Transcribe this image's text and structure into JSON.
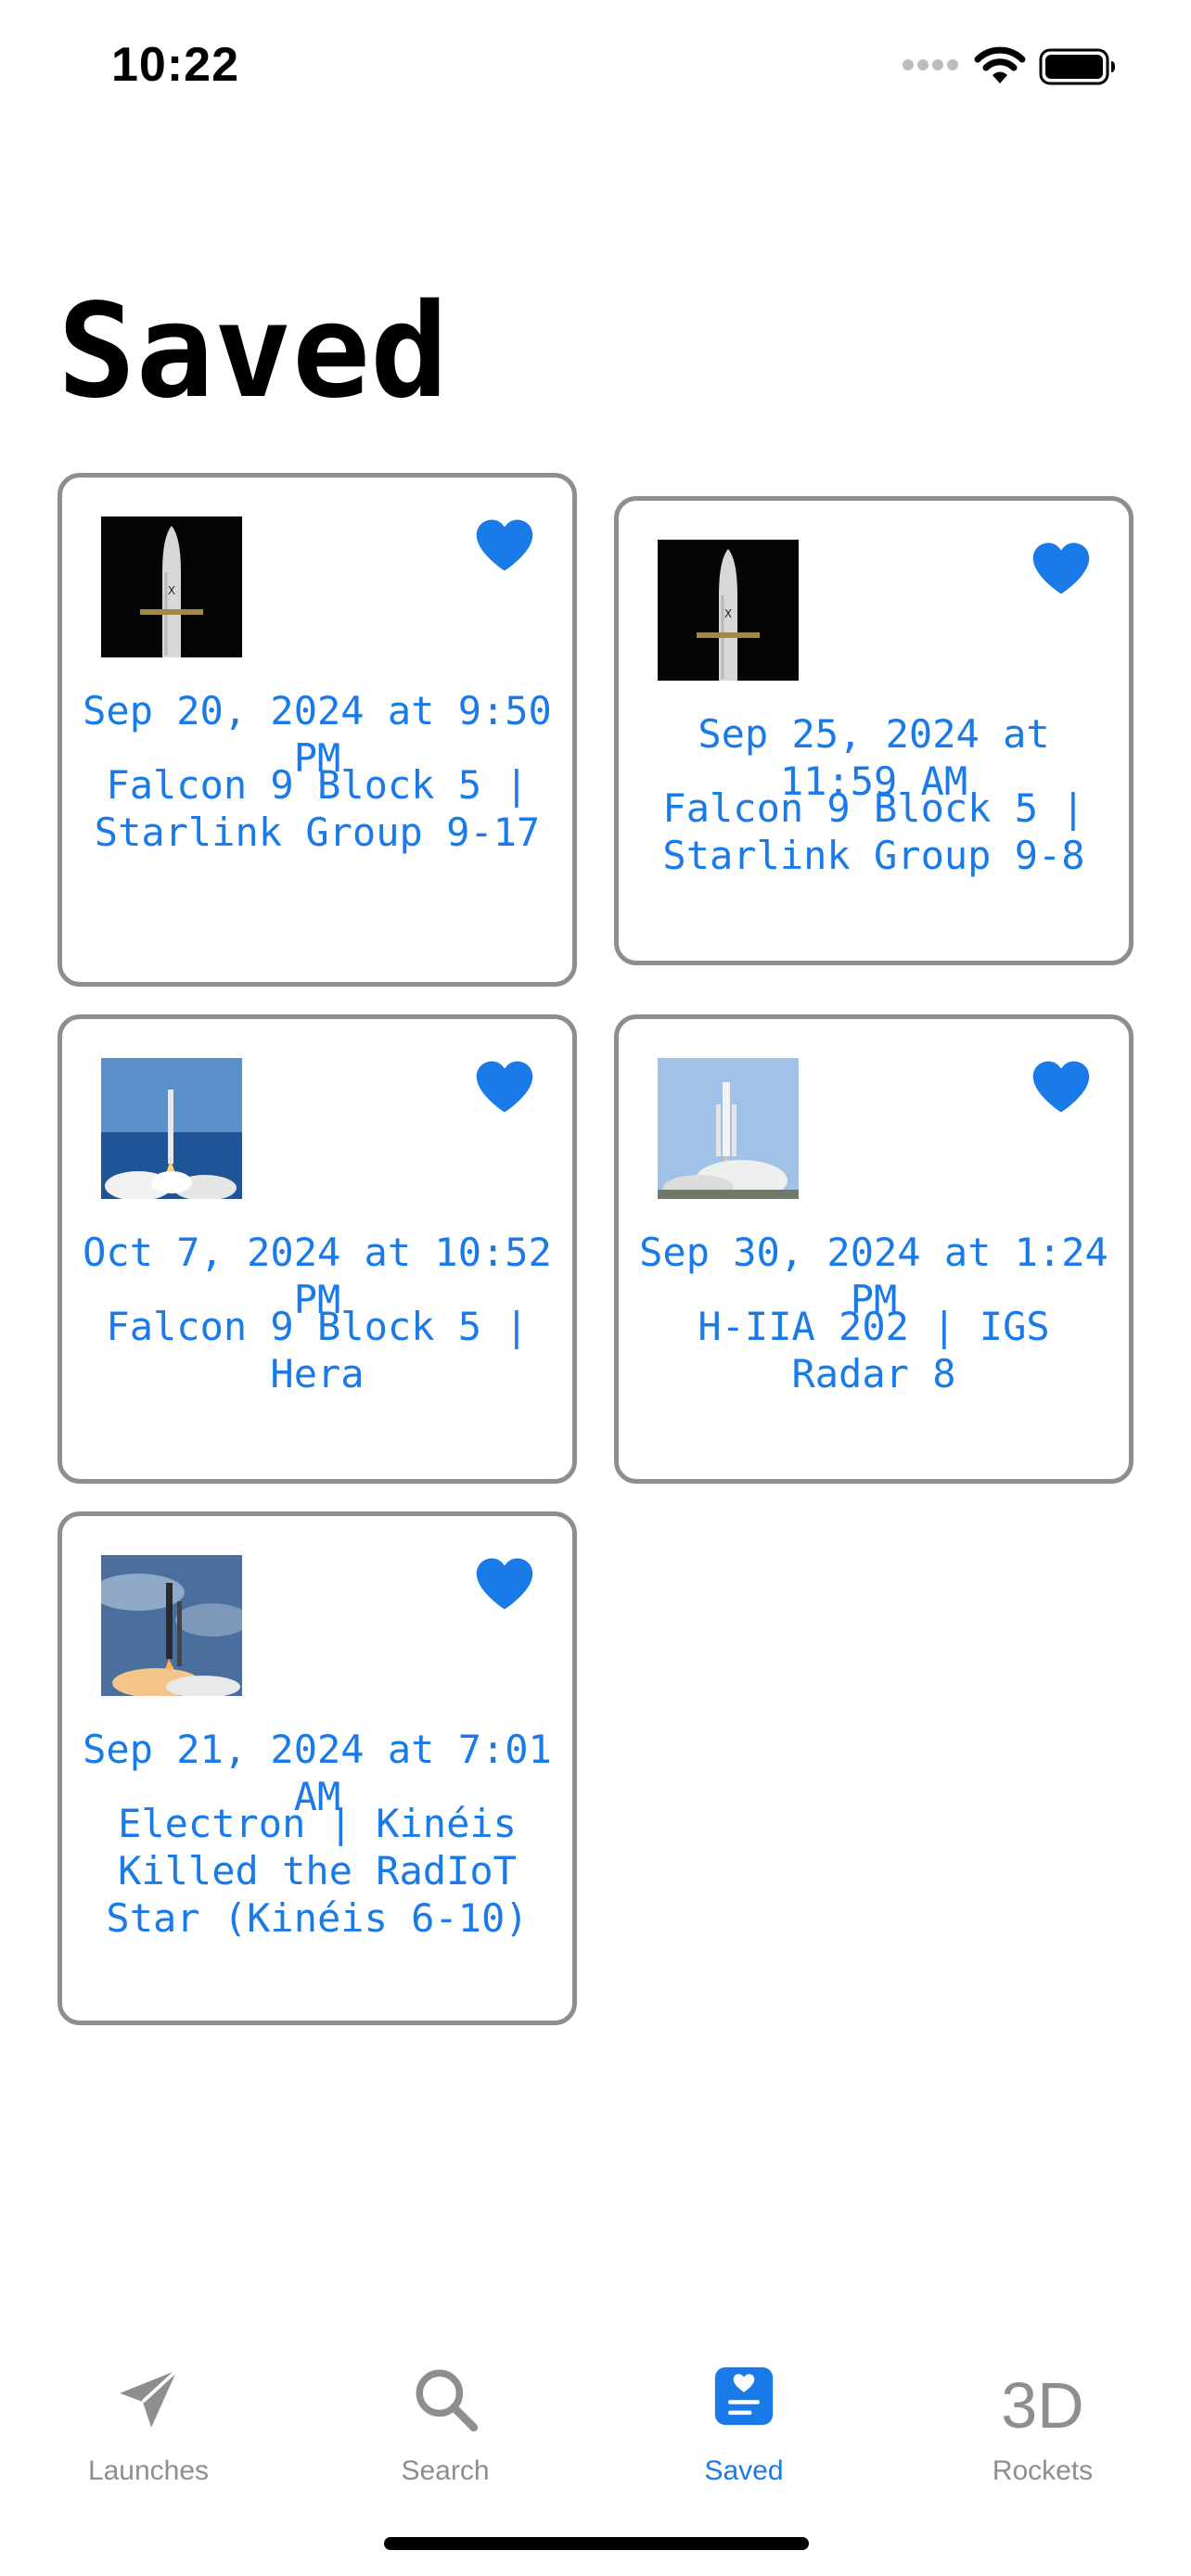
{
  "status": {
    "time": "10:22"
  },
  "title": "Saved",
  "accent": "#1a7ae8",
  "cards": [
    {
      "date": "Sep 20, 2024 at 9:50 PM",
      "name": "Falcon 9 Block 5 | Starlink Group 9-17",
      "thumb": "fairing-on-black",
      "saved": true
    },
    {
      "date": "Sep 25, 2024 at 11:59 AM",
      "name": "Falcon 9 Block 5 | Starlink Group 9-8",
      "thumb": "fairing-on-black",
      "saved": true
    },
    {
      "date": "Oct 7, 2024 at 10:52 PM",
      "name": "Falcon 9 Block 5 | Hera",
      "thumb": "rocket-launch-ocean",
      "saved": true
    },
    {
      "date": "Sep 30, 2024 at 1:24 PM",
      "name": "H-IIA 202 | IGS Radar 8",
      "thumb": "rocket-launch-sky",
      "saved": true
    },
    {
      "date": "Sep 21, 2024 at 7:01 AM",
      "name": "Electron | Kinéis Killed the RadIoT Star (Kinéis 6-10)",
      "thumb": "rocket-launch-cloudy",
      "saved": true
    }
  ],
  "tabs": [
    {
      "label": "Launches",
      "icon": "paper-plane-icon",
      "active": false
    },
    {
      "label": "Search",
      "icon": "magnifier-icon",
      "active": false
    },
    {
      "label": "Saved",
      "icon": "saved-list-icon",
      "active": true
    },
    {
      "label": "Rockets",
      "icon": "3d-icon",
      "glyph": "3D",
      "active": false
    }
  ]
}
